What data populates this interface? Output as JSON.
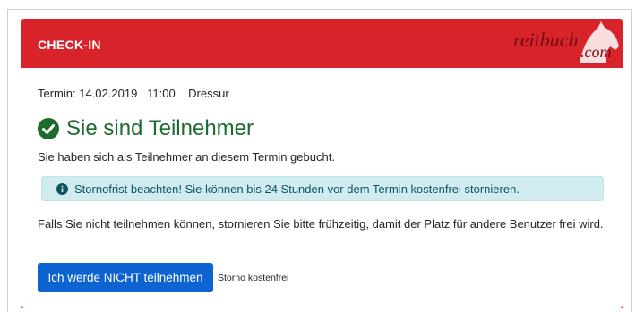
{
  "header": {
    "title": "CHECK-IN",
    "logo_text": "reitbuch",
    "logo_suffix": ".com"
  },
  "termin": {
    "text": "Termin: 14.02.2019   11:00    Dressur"
  },
  "status": {
    "title": "Sie sind Teilnehmer",
    "icon": "check-circle-icon",
    "color": "#1e6b2e"
  },
  "booked_message": "Sie haben sich als Teilnehmer an diesem Termin gebucht.",
  "alert": {
    "icon": "info-circle-icon",
    "text": "Stornofrist beachten! Sie können bis 24 Stunden vor dem Termin kostenfrei stornieren."
  },
  "cancel_info": "Falls Sie nicht teilnehmen können, stornieren Sie bitte frühzeitig, damit der Platz für andere Benutzer frei wird.",
  "actions": {
    "cancel_button_label": "Ich werde NICHT teilnehmen",
    "storno_note": "Storno kostenfrei"
  },
  "colors": {
    "header_red": "#d9232a",
    "button_blue": "#0d63cf",
    "alert_bg": "#d1ecf1",
    "alert_text": "#0c5460"
  }
}
